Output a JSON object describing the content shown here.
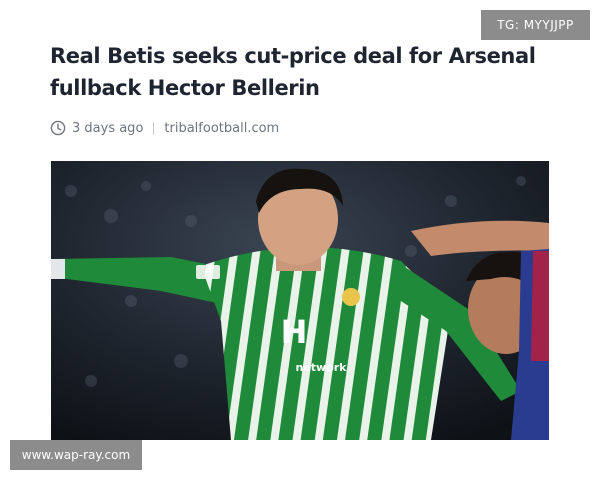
{
  "watermarks": {
    "top": "TG: MYYJJPP",
    "bottom": "www.wap-ray.com"
  },
  "article": {
    "title": "Real Betis seeks cut-price deal for Arsenal fullback Hector Bellerin",
    "time_icon": "clock-icon",
    "time_ago": "3 days ago",
    "source": "tribalfootball.com"
  },
  "photo": {
    "shirt_sponsor": "network",
    "shirt_color": "#1f8a3a",
    "opponent_shirt_color": "#2a3c8f"
  }
}
